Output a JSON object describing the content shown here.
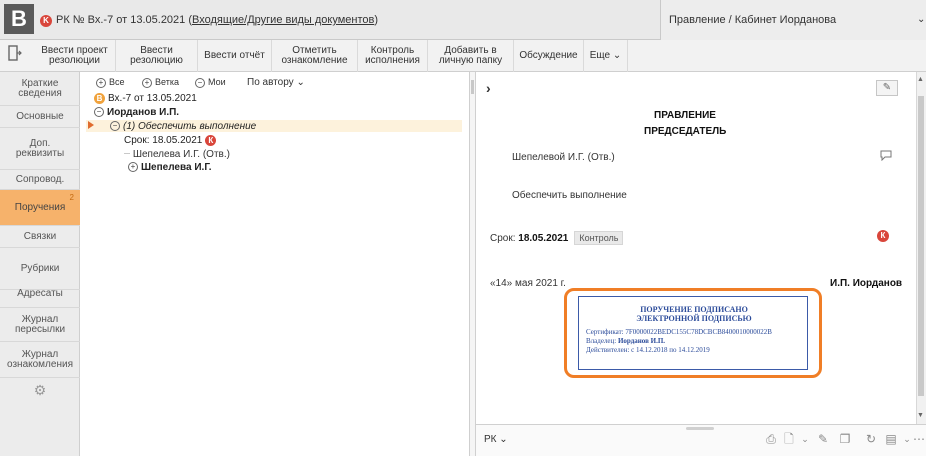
{
  "title": {
    "logo": "B",
    "k_badge": "K",
    "prefix": "РК № Вх.-7 от 13.05.2021 (",
    "link": "Входящие/Другие виды документов",
    "suffix": ")",
    "right": "Правление / Кабинет Иорданова",
    "chevron": "⌄"
  },
  "toolbar": {
    "icon": "🚪",
    "buttons": [
      {
        "label": "Ввести проект\nрезолюции"
      },
      {
        "label": "Ввести\nрезолюцию"
      },
      {
        "label": "Ввести отчёт"
      },
      {
        "label": "Отметить\nознакомление"
      },
      {
        "label": "Контроль\nисполнения"
      },
      {
        "label": "Добавить в\nличную папку"
      },
      {
        "label": "Обсуждение"
      },
      {
        "label": "Еще ⌄"
      }
    ]
  },
  "sidebar": {
    "items": [
      {
        "label": "Краткие\nсведения"
      },
      {
        "label": "Основные"
      },
      {
        "label": "Доп.\nреквизиты"
      },
      {
        "label": "Сопровод."
      },
      {
        "label": "Поручения",
        "badge": "2"
      },
      {
        "label": "Связки"
      },
      {
        "label": "Рубрики"
      },
      {
        "label": "Адресаты"
      },
      {
        "label": "Журнал\nпересылки"
      },
      {
        "label": "Журнал\nознакомления"
      },
      {
        "label": "⚙"
      }
    ]
  },
  "tree": {
    "filters": {
      "all": "Все",
      "branch": "Ветка",
      "mine": "Мои",
      "author": "По автору ⌄"
    },
    "root": "Вх.-7 от 13.05.2021",
    "root_badge": "В",
    "node_author": "Иорданов И.П.",
    "node_task": "(1) Обеспечить выполнение",
    "deadline": "Срок: 18.05.2021",
    "deadline_badge": "К",
    "executor": "Шепелева И.Г. (Отв.)",
    "sub_author": "Шепелева И.Г."
  },
  "document": {
    "expand": "›",
    "org": "ПРАВЛЕНИЕ",
    "position": "ПРЕДСЕДАТЕЛЬ",
    "addressee": "Шепелевой И.Г. (Отв.)",
    "task": "Обеспечить выполнение",
    "deadline_label": "Срок: ",
    "deadline_value": "18.05.2021",
    "control": "Контроль",
    "k_badge": "К",
    "date": "«14» мая 2021 г.",
    "signer": "И.П. Иорданов"
  },
  "stamp": {
    "line1": "ПОРУЧЕНИЕ ПОДПИСАНО",
    "line2": "ЭЛЕКТРОННОЙ ПОДПИСЬЮ",
    "cert_label": "Сертификат: ",
    "cert": "7F0000022BEDC155C78DCBCB8400010000022B",
    "owner_label": "Владелец: ",
    "owner": "Иорданов И.П.",
    "valid": "Действителен: с 14.12.2018 по 14.12.2019"
  },
  "bottom": {
    "label": "РК ⌄"
  },
  "colors": {
    "accent": "#f6b26b",
    "stamp_border": "#f07e26",
    "stamp_text": "#2b4b9a",
    "red_badge": "#d9463b"
  }
}
